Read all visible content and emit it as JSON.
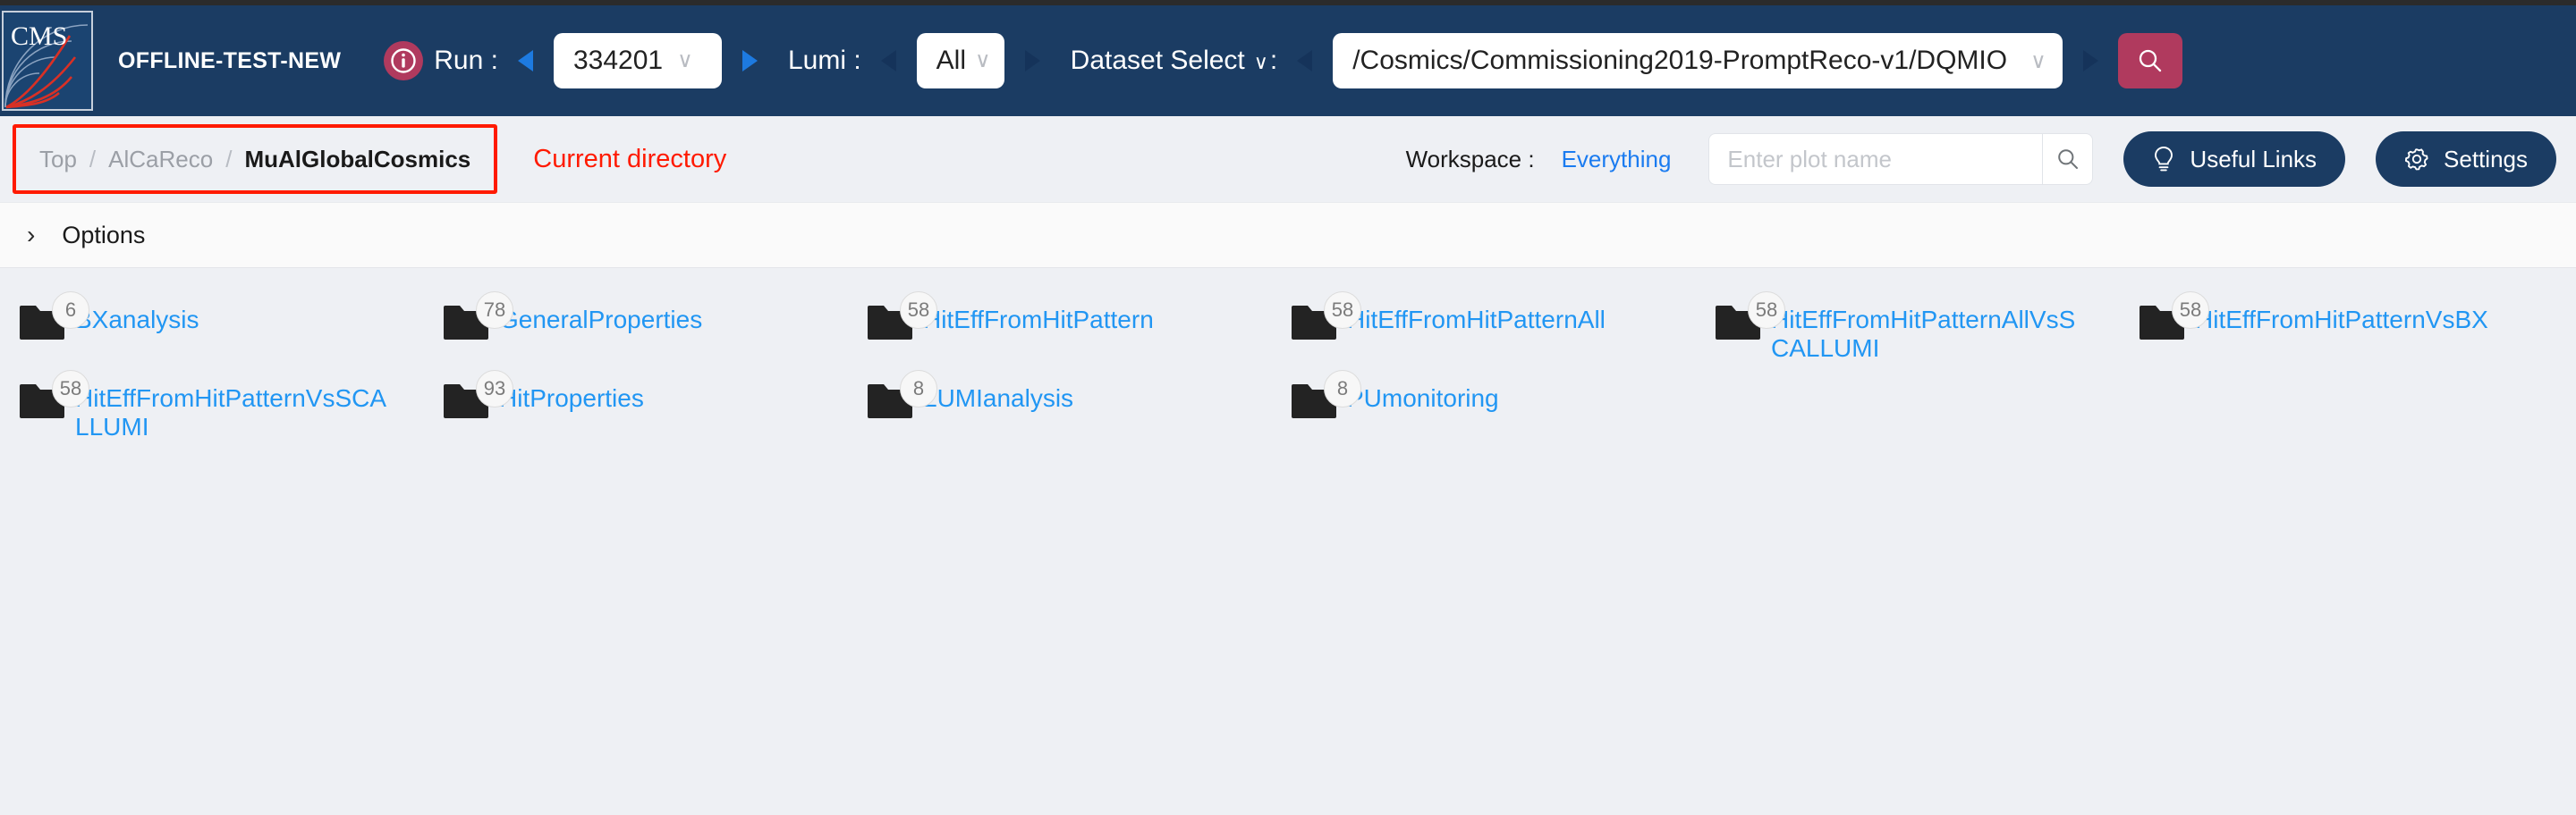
{
  "navbar": {
    "logo_text": "CMS",
    "app_name": "OFFLINE-TEST-NEW",
    "info_icon": "info-circle-icon",
    "run_label": "Run :",
    "run_value": "334201",
    "lumi_label": "Lumi :",
    "lumi_value": "All",
    "dataset_label": "Dataset Select",
    "dataset_caret": "∨",
    "dataset_label_suffix": ":",
    "dataset_value": "/Cosmics/Commissioning2019-PromptReco-v1/DQMIO",
    "caret": "∨",
    "search_icon": "search-icon",
    "bg_color": "#1b3c63",
    "accent_color": "#b03a5e"
  },
  "toolbar": {
    "breadcrumb": [
      {
        "label": "Top",
        "active": false
      },
      {
        "label": "AlCaReco",
        "active": false
      },
      {
        "label": "MuAlGlobalCosmics",
        "active": true
      }
    ],
    "breadcrumb_separator": "/",
    "annotation": "Current directory",
    "annotation_color": "#ff1a00",
    "workspace_label": "Workspace :",
    "workspace_value": "Everything",
    "plot_search_placeholder": "Enter plot name",
    "plot_search_value": "",
    "plot_search_icon": "search-icon",
    "useful_links_label": "Useful Links",
    "useful_links_icon": "lightbulb-icon",
    "settings_label": "Settings",
    "settings_icon": "gear-icon"
  },
  "options": {
    "chevron": "›",
    "label": "Options"
  },
  "folders": [
    {
      "name": "BXanalysis",
      "count": "6"
    },
    {
      "name": "GeneralProperties",
      "count": "78"
    },
    {
      "name": "HitEffFromHitPattern",
      "count": "58"
    },
    {
      "name": "HitEffFromHitPatternAll",
      "count": "58"
    },
    {
      "name": "HitEffFromHitPatternAllVsSCALLUMI",
      "count": "58"
    },
    {
      "name": "HitEffFromHitPatternVsBX",
      "count": "58"
    },
    {
      "name": "HitEffFromHitPatternVsSCALLUMI",
      "count": "58"
    },
    {
      "name": "HitProperties",
      "count": "93"
    },
    {
      "name": "LUMIanalysis",
      "count": "8"
    },
    {
      "name": "PUmonitoring",
      "count": "8"
    }
  ]
}
